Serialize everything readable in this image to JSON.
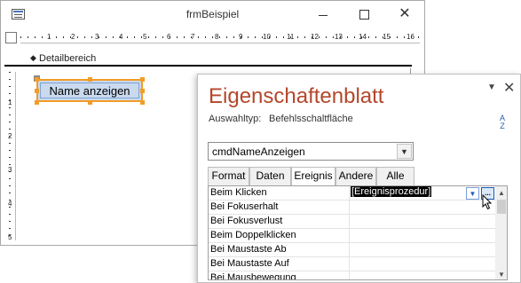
{
  "form_window": {
    "title": "frmBeispiel",
    "close_glyph": "✕",
    "section_label": "Detailbereich",
    "section_arrow": "◆",
    "ruler_numbers": [
      "1",
      "2",
      "3",
      "4",
      "5",
      "6",
      "7",
      "8",
      "9",
      "10",
      "11",
      "12",
      "13",
      "14",
      "15",
      "16"
    ],
    "vruler_numbers": [
      "1",
      "2",
      "3",
      "4",
      "5"
    ],
    "button_caption": "Name anzeigen"
  },
  "property_sheet": {
    "title": "Eigenschaftenblatt",
    "pin_glyph": "▼",
    "close_glyph": "✕",
    "selection_type_label": "Auswahltyp:",
    "selection_type_value": "Befehlsschaltfläche",
    "sort_glyph_top": "A",
    "sort_glyph_bottom": "Z",
    "object_selector": "cmdNameAnzeigen",
    "dropdown_glyph": "▼",
    "tabs": [
      "Format",
      "Daten",
      "Ereignis",
      "Andere",
      "Alle"
    ],
    "active_tab": "Ereignis",
    "rows": [
      {
        "name": "Beim Klicken",
        "value": "[Ereignisprozedur]"
      },
      {
        "name": "Bei Fokuserhalt",
        "value": ""
      },
      {
        "name": "Bei Fokusverlust",
        "value": ""
      },
      {
        "name": "Beim Doppelklicken",
        "value": ""
      },
      {
        "name": "Bei Maustaste Ab",
        "value": ""
      },
      {
        "name": "Bei Maustaste Auf",
        "value": ""
      },
      {
        "name": "Bei Mausbewegung",
        "value": ""
      }
    ],
    "builder_glyph": "...",
    "row_dropdown_glyph": "▼",
    "scroll_up_glyph": "▲",
    "scroll_down_glyph": "▼"
  },
  "colors": {
    "accent_title": "#b4472b",
    "selection_orange": "#f39c27",
    "button_fill": "#c9d9ee"
  }
}
